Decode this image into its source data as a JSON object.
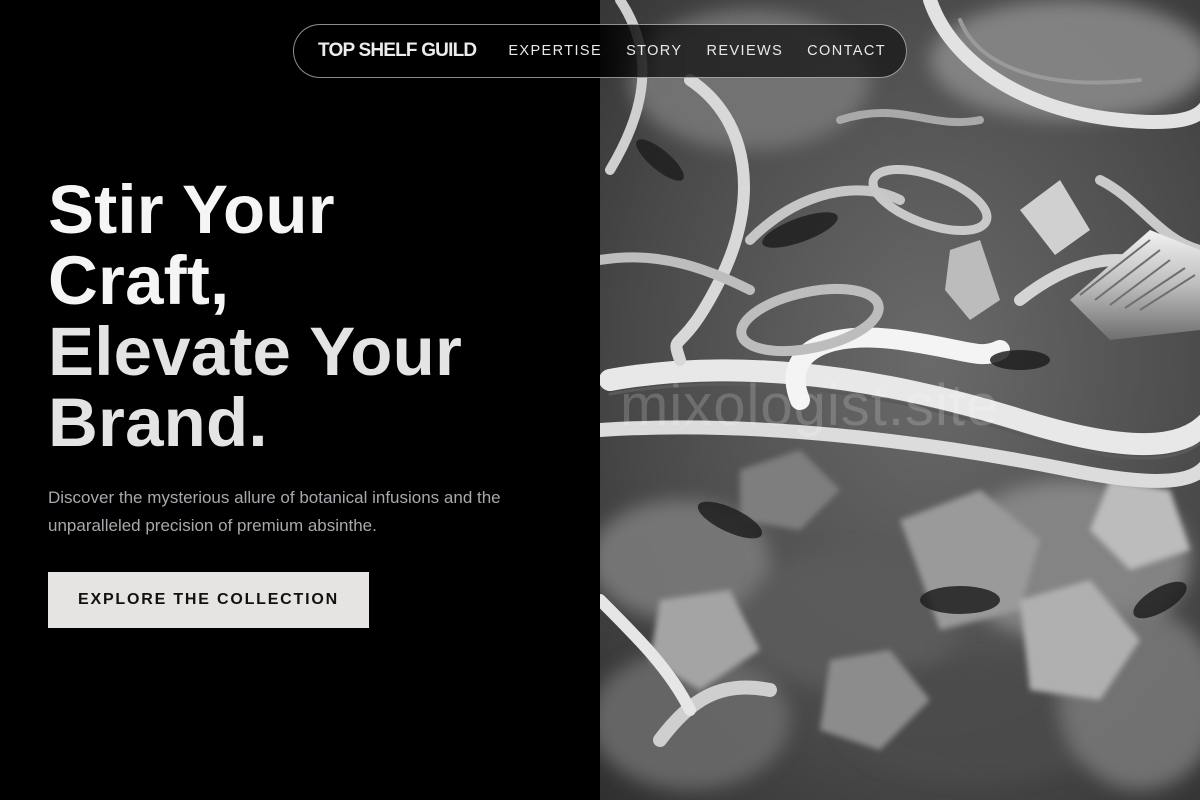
{
  "nav": {
    "brand": "TOP SHELF GUILD",
    "links": [
      "EXPERTISE",
      "STORY",
      "REVIEWS",
      "CONTACT"
    ]
  },
  "hero": {
    "headline_lines": [
      "Stir Your",
      "Craft,",
      "Elevate Your",
      "Brand."
    ],
    "subtext": "Discover the mysterious allure of botanical infusions and the unparalleled precision of premium absinthe.",
    "cta_label": "EXPLORE THE COLLECTION",
    "image_watermark": "mixologist.site"
  },
  "colors": {
    "background": "#000000",
    "cta_background": "#e6e4e2",
    "subtext": "#a8a8ae"
  }
}
